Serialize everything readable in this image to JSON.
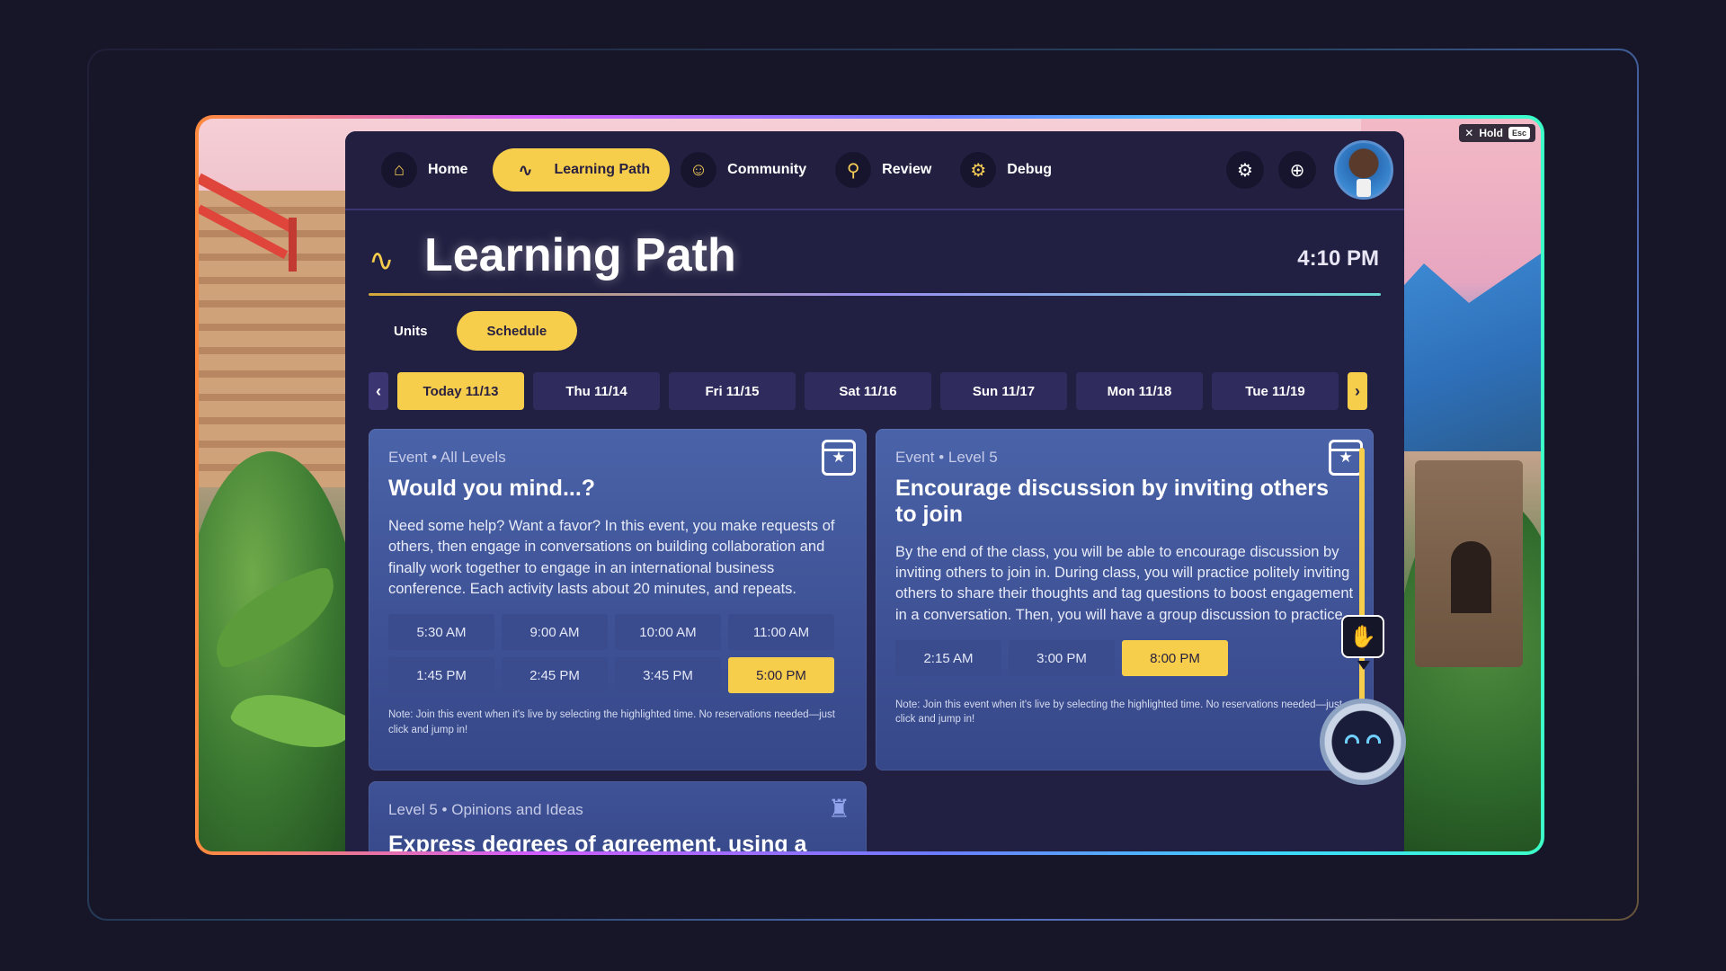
{
  "overlay": {
    "hold_label": "Hold",
    "esc_label": "Esc"
  },
  "nav": {
    "items": [
      {
        "label": "Home",
        "icon": "home-icon"
      },
      {
        "label": "Learning Path",
        "icon": "path-icon",
        "active": true
      },
      {
        "label": "Community",
        "icon": "people-icon"
      },
      {
        "label": "Review",
        "icon": "magnifier-icon"
      },
      {
        "label": "Debug",
        "icon": "gear-icon"
      }
    ],
    "settings_icon": "settings-icon",
    "help_icon": "lifebuoy-icon"
  },
  "header": {
    "title": "Learning Path",
    "time": "4:10 PM"
  },
  "subtabs": [
    {
      "label": "Units"
    },
    {
      "label": "Schedule",
      "active": true
    }
  ],
  "days": [
    {
      "label": "Today 11/13",
      "active": true
    },
    {
      "label": "Thu 11/14"
    },
    {
      "label": "Fri 11/15"
    },
    {
      "label": "Sat 11/16"
    },
    {
      "label": "Sun 11/17"
    },
    {
      "label": "Mon 11/18"
    },
    {
      "label": "Tue 11/19"
    }
  ],
  "cards": [
    {
      "eyebrow": "Event • All Levels",
      "title": "Would you mind...?",
      "description": "Need some help? Want a favor? In this event, you make requests of others, then engage in conversations on building collaboration and finally work together to engage in an international business conference. Each activity lasts about 20 minutes, and repeats.",
      "times": [
        "5:30 AM",
        "9:00 AM",
        "10:00 AM",
        "11:00 AM",
        "1:45 PM",
        "2:45 PM",
        "3:45 PM",
        "5:00 PM"
      ],
      "active_time": "5:00 PM",
      "note": "Note: Join this event when it's live by selecting the highlighted time. No reservations needed—just click and jump in!"
    },
    {
      "eyebrow": "Event • Level 5",
      "title": "Encourage discussion by inviting others to join",
      "description": "By the end of the class, you will be able to encourage discussion by inviting others to join in. During class, you will practice politely inviting others to share their thoughts and tag questions to boost engagement in a conversation. Then, you will have a group discussion to practice.",
      "times": [
        "2:15 AM",
        "3:00 PM",
        "8:00 PM"
      ],
      "active_time": "8:00 PM",
      "note": "Note: Join this event when it's live by selecting the highlighted time. No reservations needed—just click and jump in!"
    },
    {
      "eyebrow": "Level 5 • Opinions and Ideas",
      "title": "Express degrees of agreement, using a"
    }
  ],
  "colors": {
    "accent": "#f6ce4b",
    "panel": "#222042",
    "card": "#4a63a8"
  }
}
